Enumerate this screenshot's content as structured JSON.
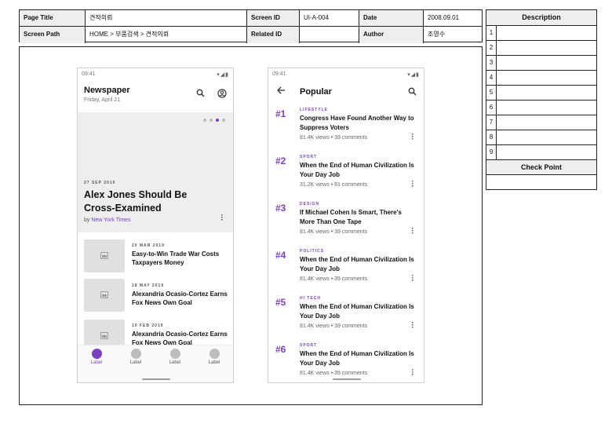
{
  "header": {
    "page_title_label": "Page Title",
    "page_title_value": "견적의뢰",
    "screen_id_label": "Screen ID",
    "screen_id_value": "UI-A-004",
    "date_label": "Date",
    "date_value": "2008.09.01",
    "screen_path_label": "Screen Path",
    "screen_path_value": "HOME > 부품검색 > 견적의뢰",
    "related_id_label": "Related ID",
    "related_id_value": "",
    "author_label": "Author",
    "author_value": "조영수"
  },
  "description": {
    "title": "Description",
    "rows": [
      "1",
      "2",
      "3",
      "4",
      "5",
      "6",
      "7",
      "8",
      "9"
    ],
    "check_point_title": "Check Point"
  },
  "newspaper_screen": {
    "status_time": "09:41",
    "title": "Newspaper",
    "date": "Friday, April 21",
    "featured": {
      "date": "27 SEP 2019",
      "title": "Alex Jones Should Be Cross-Examined",
      "by_prefix": "by",
      "source": "New York Times"
    },
    "articles": [
      {
        "date": "20 MAR 2019",
        "title": "Easy-to-Win Trade War Costs Taxpayers Money"
      },
      {
        "date": "28 MAY 2019",
        "title": "Alexandria Ocasio-Cortez Earns Fox News Own Goal"
      },
      {
        "date": "10 FEB 2019",
        "title": "Alexandria Ocasio-Cortez Earns Fox News Own Goal"
      }
    ],
    "nav": [
      "Label",
      "Label",
      "Label",
      "Label"
    ],
    "carousel_active_index": 2
  },
  "popular_screen": {
    "status_time": "09:41",
    "title": "Popular",
    "items": [
      {
        "rank": "#1",
        "category": "LIFESTYLE",
        "title": "Congress Have Found Another Way to Suppress Voters",
        "meta": "81.4K views • 39 comments"
      },
      {
        "rank": "#2",
        "category": "SPORT",
        "title": "When the End of Human Civilization Is Your Day Job",
        "meta": "31.2K views • 81 comments"
      },
      {
        "rank": "#3",
        "category": "DESIGN",
        "title": "If Michael Cohen Is Smart, There's More Than One Tape",
        "meta": "81.4K views • 39 comments"
      },
      {
        "rank": "#4",
        "category": "POLITICS",
        "title": "When the End of Human Civilization Is Your Day Job",
        "meta": "81.4K views • 39 comments"
      },
      {
        "rank": "#5",
        "category": "HI TECH",
        "title": "When the End of Human Civilization Is Your Day Job",
        "meta": "81.4K views • 39 comments"
      },
      {
        "rank": "#6",
        "category": "SPORT",
        "title": "When the End of Human Civilization Is Your Day Job",
        "meta": "81.4K views • 39 comments"
      }
    ]
  },
  "colors": {
    "accent": "#7b3fc2",
    "placeholder_gray": "#eeeeee",
    "border": "#222222"
  },
  "icons": {
    "search": "search-icon",
    "account": "account-circle-icon",
    "back": "arrow-back-icon",
    "more": "more-vert-icon",
    "image": "image-icon",
    "wifi": "wifi-icon",
    "signal": "signal-icon",
    "battery": "battery-icon"
  }
}
